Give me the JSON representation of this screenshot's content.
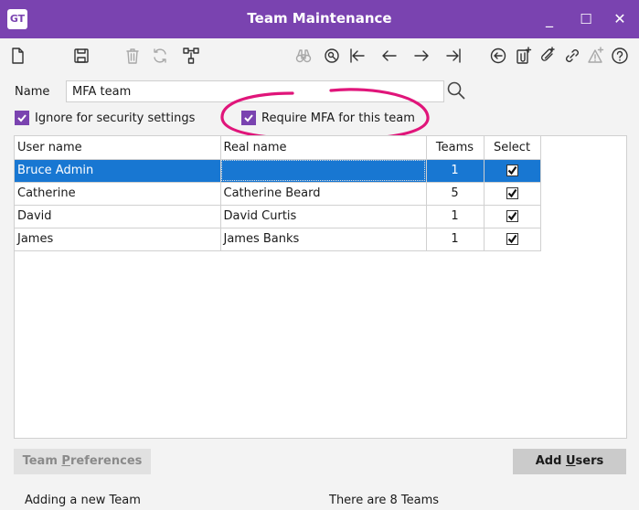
{
  "window": {
    "logo_text": "GT",
    "title": "Team Maintenance",
    "controls": {
      "minimize": "_",
      "maximize": "☐",
      "close": "✕"
    }
  },
  "toolbar": {
    "left_icons": [
      "new-document-icon",
      "save-icon",
      "delete-icon",
      "refresh-icon",
      "hierarchy-icon"
    ],
    "right_icons": [
      "binoculars-icon",
      "find-icon",
      "first-icon",
      "previous-icon",
      "next-icon",
      "last-icon",
      "back-icon",
      "add-attachment-icon",
      "attachment-icon",
      "link-icon",
      "add-alert-icon",
      "help-icon"
    ]
  },
  "form": {
    "name_label": "Name",
    "name_value": "MFA team",
    "ignore_security_label": "Ignore for security settings",
    "ignore_security_checked": true,
    "require_mfa_label": "Require MFA for this team",
    "require_mfa_checked": true
  },
  "grid": {
    "columns": [
      "User name",
      "Real name",
      "Teams",
      "Select"
    ],
    "rows": [
      {
        "user": "Bruce Admin",
        "real": "",
        "teams": "1",
        "select": true,
        "selected": true
      },
      {
        "user": "Catherine",
        "real": "Catherine Beard",
        "teams": "5",
        "select": true,
        "selected": false
      },
      {
        "user": "David",
        "real": "David Curtis",
        "teams": "1",
        "select": true,
        "selected": false
      },
      {
        "user": "James",
        "real": "James Banks",
        "teams": "1",
        "select": true,
        "selected": false
      }
    ]
  },
  "buttons": {
    "team_preferences": {
      "pre": "Team ",
      "underline": "P",
      "post": "references"
    },
    "add_users": {
      "pre": "Add ",
      "underline": "U",
      "post": "sers"
    }
  },
  "status": {
    "left": "Adding a new Team",
    "right": "There are 8 Teams"
  },
  "colors": {
    "accent": "#7a43b0",
    "selection": "#1877d2",
    "highlight_circle": "#e0157a"
  }
}
